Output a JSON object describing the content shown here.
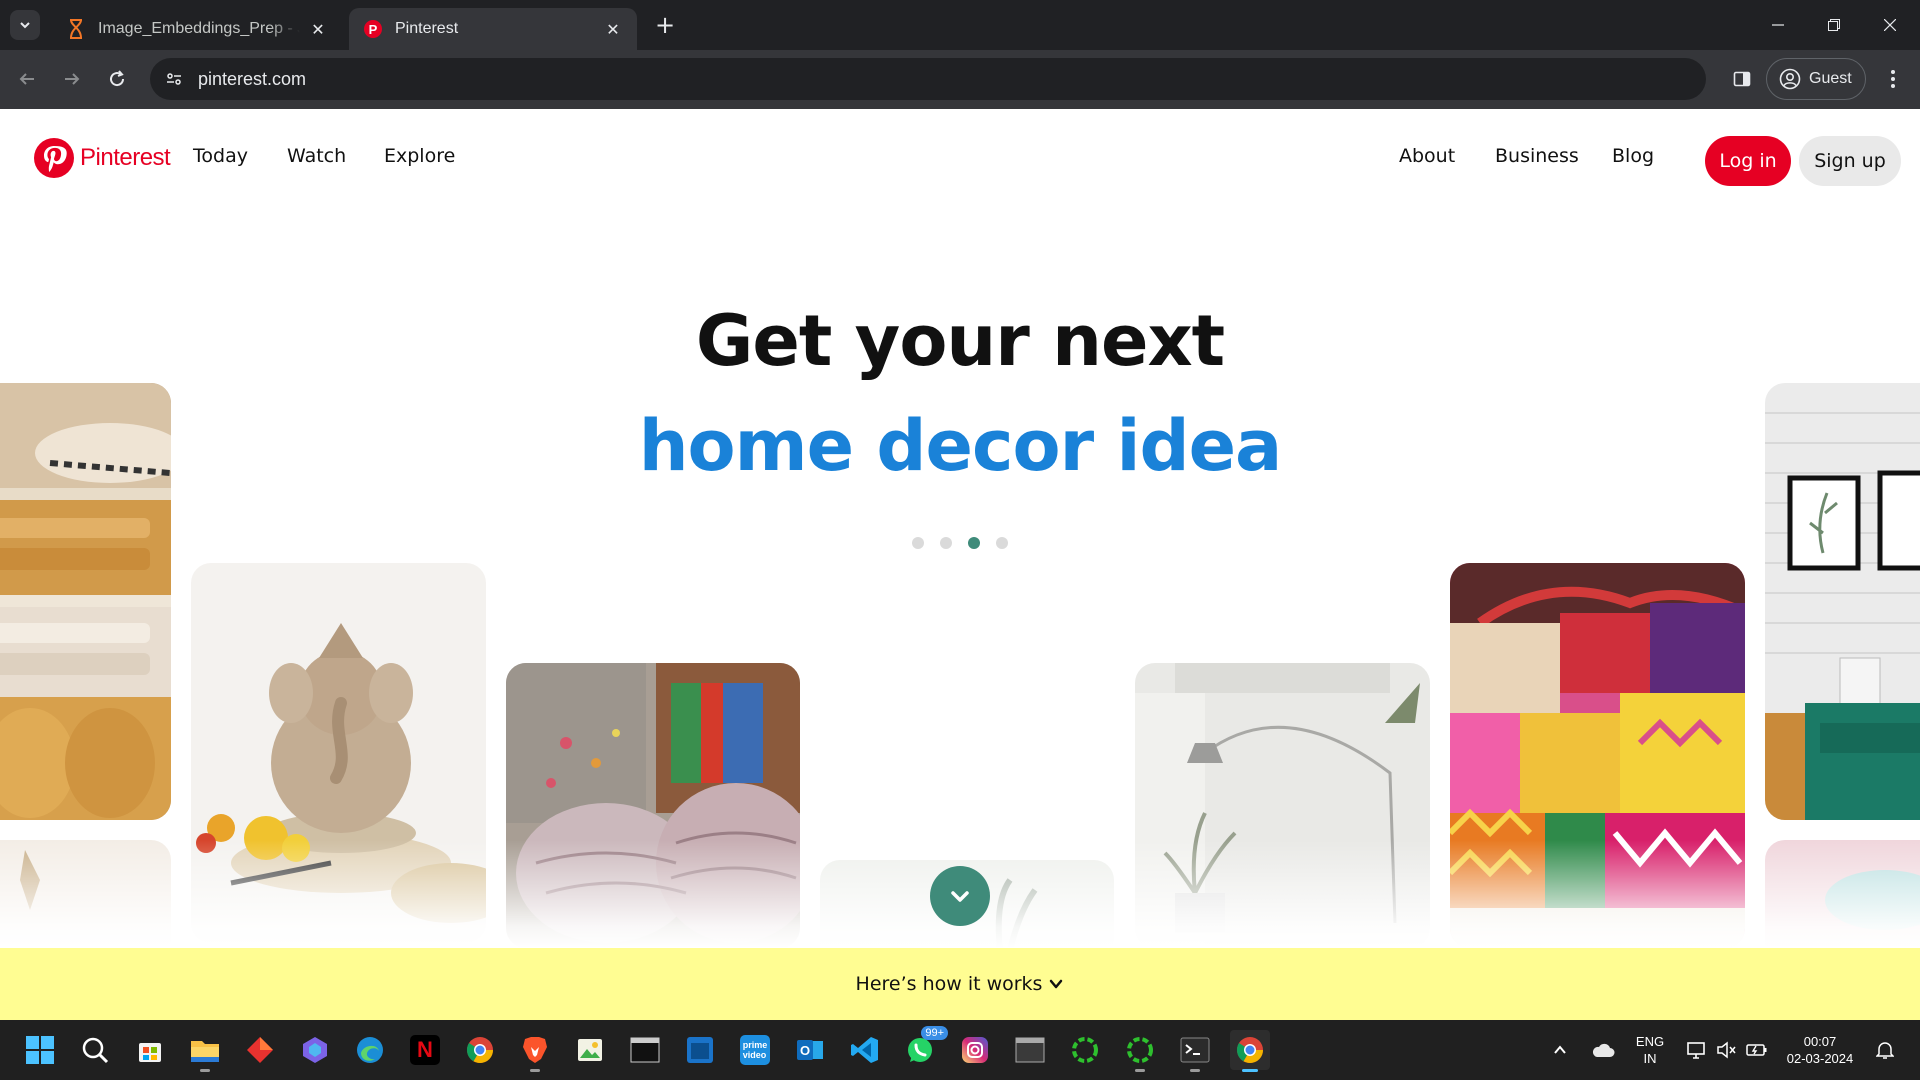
{
  "browser": {
    "tabs": [
      {
        "title": "Image_Embeddings_Prep - Jupyter Notebook",
        "active": false,
        "favicon": "hourglass-icon"
      },
      {
        "title": "Pinterest",
        "active": true,
        "favicon": "pinterest-icon"
      }
    ],
    "url": "pinterest.com",
    "profile_label": "Guest"
  },
  "pinterest": {
    "brand": "Pinterest",
    "nav_left": [
      "Today",
      "Watch",
      "Explore"
    ],
    "nav_right": [
      "About",
      "Business",
      "Blog"
    ],
    "login_label": "Log in",
    "signup_label": "Sign up",
    "hero_line1": "Get your next",
    "hero_line2": "home decor idea",
    "carousel": {
      "count": 4,
      "active_index": 2
    },
    "how_it_works_label": "Here’s how it works",
    "colors": {
      "brand_red": "#e60023",
      "hero_blue": "#1a82d8",
      "accent_green": "#3f8b7a",
      "banner_yellow": "#fffd92"
    }
  },
  "taskbar": {
    "apps": [
      "windows-start",
      "search",
      "microsoft-store",
      "file-explorer",
      "app-red-diamond",
      "copilot",
      "edge",
      "netflix",
      "chrome",
      "brave",
      "photos",
      "console",
      "app-blue-tile",
      "prime-video",
      "outlook",
      "vscode",
      "whatsapp",
      "instagram",
      "window-app",
      "spinner-app-1",
      "spinner-app-2",
      "terminal",
      "chrome-active"
    ],
    "whatsapp_badge": "99+",
    "language": "ENG",
    "region": "IN",
    "time": "00:07",
    "date": "02-03-2024"
  }
}
